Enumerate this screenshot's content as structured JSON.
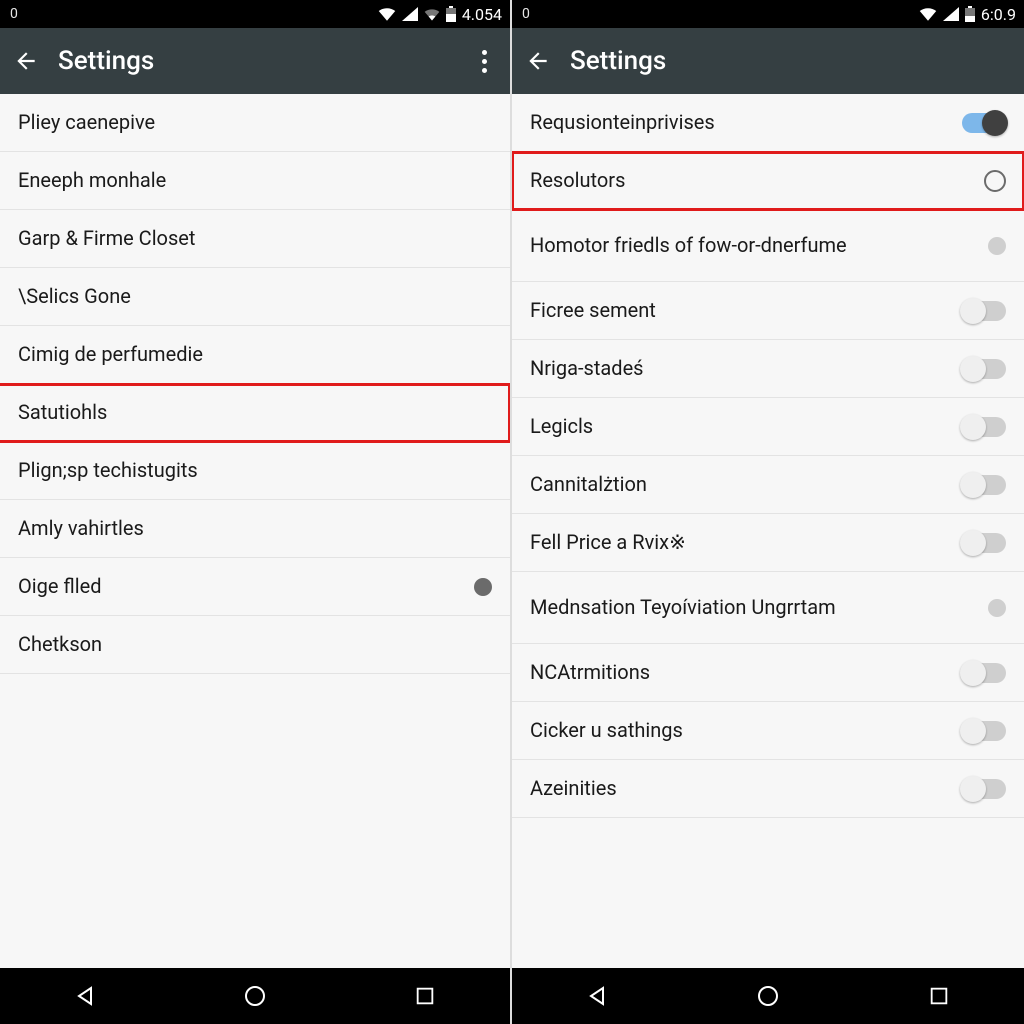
{
  "left": {
    "status": {
      "left_indicator": "0",
      "time": "4.054"
    },
    "appbar": {
      "title": "Settings"
    },
    "items": [
      {
        "label": "Pliey caenepive",
        "control": "none",
        "highlight": false
      },
      {
        "label": "Eneeph monhale",
        "control": "none",
        "highlight": false
      },
      {
        "label": "Garp & Firme Closet",
        "control": "none",
        "highlight": false
      },
      {
        "label": "\\Selics Gone",
        "control": "none",
        "highlight": false
      },
      {
        "label": "Cimig de perfumedie",
        "control": "none",
        "highlight": false
      },
      {
        "label": "Satutiohls",
        "control": "none",
        "highlight": true
      },
      {
        "label": "Plign;sp techistugits",
        "control": "none",
        "highlight": false
      },
      {
        "label": "Amly vahirtles",
        "control": "none",
        "highlight": false
      },
      {
        "label": "Oige flled",
        "control": "dot",
        "highlight": false
      },
      {
        "label": "Chetkson",
        "control": "none",
        "highlight": false
      }
    ]
  },
  "right": {
    "status": {
      "left_indicator": "0",
      "time": "6:0.9"
    },
    "appbar": {
      "title": "Settings"
    },
    "items": [
      {
        "label": "Requsionteinprivises",
        "control": "toggle",
        "on": true,
        "highlight": false
      },
      {
        "label": "Resolutors",
        "control": "radio",
        "on": false,
        "highlight": true
      },
      {
        "label": "Homotor friedls of fow-or-dnerfume",
        "control": "dot-off",
        "on": false,
        "highlight": false,
        "twoLine": true
      },
      {
        "label": "Ficree sement",
        "control": "toggle",
        "on": false,
        "highlight": false
      },
      {
        "label": "Nriga-stadeś",
        "control": "toggle",
        "on": false,
        "highlight": false
      },
      {
        "label": "Legicls",
        "control": "toggle",
        "on": false,
        "highlight": false
      },
      {
        "label": "Cannitalżtion",
        "control": "toggle",
        "on": false,
        "highlight": false
      },
      {
        "label": "Fell Price a Rvix※",
        "control": "toggle",
        "on": false,
        "highlight": false
      },
      {
        "label": "Mednsation Teyoíviation Ungrrtam",
        "control": "dot-off",
        "on": false,
        "highlight": false,
        "twoLine": true
      },
      {
        "label": "NCAtrmitions",
        "control": "toggle",
        "on": false,
        "highlight": false
      },
      {
        "label": "Cicker u sathings",
        "control": "toggle",
        "on": false,
        "highlight": false
      },
      {
        "label": "Azeinities",
        "control": "toggle",
        "on": false,
        "highlight": false
      }
    ]
  },
  "nav": {
    "back": "back",
    "home": "home",
    "recent": "recent"
  }
}
